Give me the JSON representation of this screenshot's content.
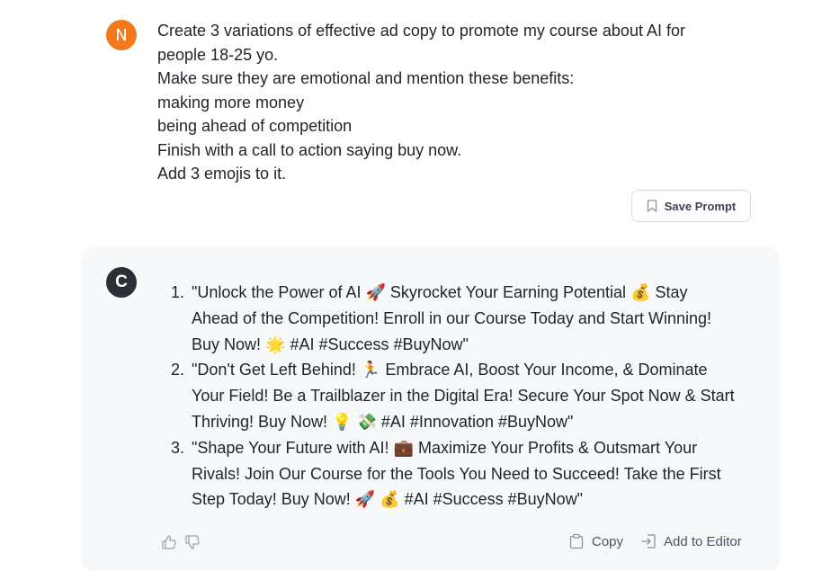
{
  "user": {
    "avatar_letter": "N",
    "message_lines": [
      "Create 3 variations of effective ad copy to promote my course about AI for",
      "people 18-25 yo.",
      "Make sure they are emotional and mention these benefits:",
      "making more money",
      "being ahead of competition",
      "Finish with a call to action saying buy now.",
      "Add 3 emojis to it."
    ],
    "save_prompt_label": "Save Prompt"
  },
  "assistant": {
    "avatar_letter": "C",
    "items": [
      {
        "number": "1.",
        "lines": [
          "\"Unlock the Power of AI 🚀 Skyrocket Your Earning Potential 💰 Stay",
          "Ahead of the Competition! Enroll in our Course Today and Start Winning!",
          "Buy Now! 🌟 #AI #Success #BuyNow\""
        ]
      },
      {
        "number": "2.",
        "lines": [
          "\"Don't Get Left Behind! 🏃 Embrace AI, Boost Your Income, & Dominate",
          "Your Field! Be a Trailblazer in the Digital Era! Secure Your Spot Now & Start",
          "Thriving! Buy Now! 💡 💸 #AI #Innovation #BuyNow\""
        ]
      },
      {
        "number": "3.",
        "lines": [
          "\"Shape Your Future with AI! 💼 Maximize Your Profits & Outsmart Your",
          "Rivals! Join Our Course for the Tools You Need to Succeed! Take the First",
          "Step Today! Buy Now! 🚀 💰 #AI #Success #BuyNow\""
        ]
      }
    ],
    "actions": {
      "copy_label": "Copy",
      "add_to_editor_label": "Add to Editor"
    }
  },
  "colors": {
    "user_avatar": "#f07a1a",
    "assistant_avatar": "#2b2f36",
    "card_background": "#f6f8fa"
  },
  "icons": [
    "bookmark-icon",
    "thumbs-up-icon",
    "thumbs-down-icon",
    "clipboard-icon",
    "add-to-editor-icon"
  ]
}
